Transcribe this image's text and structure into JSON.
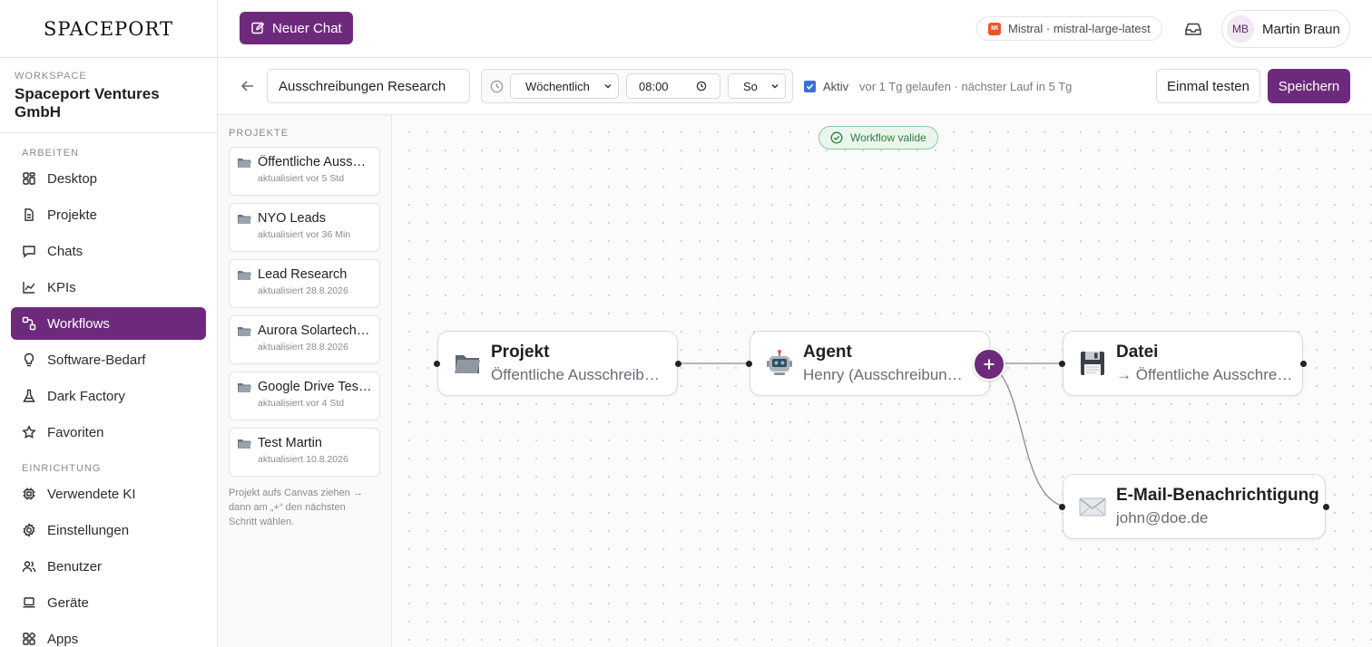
{
  "brand": {
    "logo_text": "SPACEPORT"
  },
  "workspace": {
    "label": "WORKSPACE",
    "name": "Spaceport Ventures GmbH"
  },
  "sidebar": {
    "section_work": "ARBEITEN",
    "section_setup": "EINRICHTUNG",
    "work_items": [
      {
        "label": "Desktop",
        "icon": "grid-icon"
      },
      {
        "label": "Projekte",
        "icon": "document-icon"
      },
      {
        "label": "Chats",
        "icon": "chat-icon"
      },
      {
        "label": "KPIs",
        "icon": "chart-icon"
      },
      {
        "label": "Workflows",
        "icon": "workflow-icon",
        "active": true
      },
      {
        "label": "Software-Bedarf",
        "icon": "lightbulb-icon"
      },
      {
        "label": "Dark Factory",
        "icon": "flask-icon"
      },
      {
        "label": "Favoriten",
        "icon": "star-icon"
      }
    ],
    "setup_items": [
      {
        "label": "Verwendete KI",
        "icon": "chip-icon"
      },
      {
        "label": "Einstellungen",
        "icon": "gear-icon"
      },
      {
        "label": "Benutzer",
        "icon": "users-icon"
      },
      {
        "label": "Geräte",
        "icon": "laptop-icon"
      },
      {
        "label": "Apps",
        "icon": "apps-icon"
      }
    ]
  },
  "topbar": {
    "new_chat_label": "Neuer Chat",
    "model_badge": "MI",
    "model_label": "Mistral · mistral-large-latest",
    "user_initials": "MB",
    "user_name": "Martin Braun"
  },
  "toolbar": {
    "workflow_name": "Ausschreibungen Research",
    "frequency": "Wöchentlich",
    "time": "08:00",
    "weekday": "So",
    "active_label": "Aktiv",
    "active": true,
    "run_info": "vor 1 Tg gelaufen · nächster Lauf in 5 Tg",
    "test_label": "Einmal testen",
    "save_label": "Speichern"
  },
  "projects": {
    "label": "PROJEKTE",
    "items": [
      {
        "title": "Öffentliche Ausschreibungen",
        "meta": "aktualisiert vor 5 Std"
      },
      {
        "title": "NYO Leads",
        "meta": "aktualisiert vor 36 Min"
      },
      {
        "title": "Lead Research",
        "meta": "aktualisiert 28.8.2026"
      },
      {
        "title": "Aurora Solartechnik",
        "meta": "aktualisiert 28.8.2026"
      },
      {
        "title": "Google Drive Test Projekt",
        "meta": "aktualisiert vor 4 Std"
      },
      {
        "title": "Test Martin",
        "meta": "aktualisiert 10.8.2026"
      }
    ],
    "hint": "Projekt aufs Canvas ziehen → dann am „+“ den nächsten Schritt wählen."
  },
  "canvas": {
    "status_label": "Workflow valide",
    "nodes": [
      {
        "title": "Projekt",
        "subtitle": "Öffentliche Ausschreibungen",
        "icon": "folder-icon"
      },
      {
        "title": "Agent",
        "subtitle": "Henry (Ausschreibung Research)",
        "icon": "robot-icon"
      },
      {
        "title": "Datei",
        "subtitle": "→ Öffentliche Ausschreibungen",
        "icon": "floppy-disk-icon"
      },
      {
        "title": "E-Mail-Benachrichtigung",
        "subtitle": "john@doe.de",
        "icon": "envelope-icon"
      }
    ]
  },
  "colors": {
    "accent": "#6d2a7c",
    "valid_green": "#2e7d3f",
    "checkbox_blue": "#3b6fd6"
  }
}
